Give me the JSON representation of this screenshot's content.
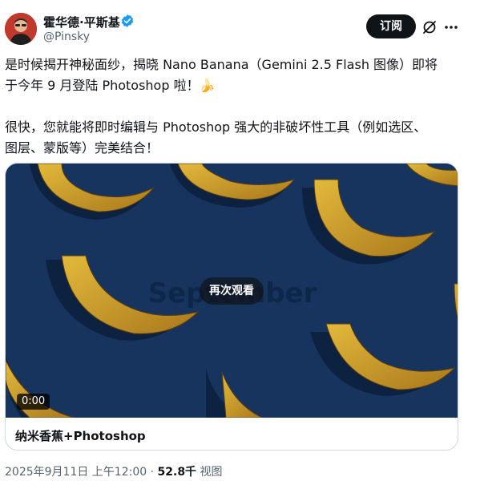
{
  "author": {
    "name": "霍华德·平斯基",
    "handle": "@Pinsky",
    "avatar_icon": "avatar-portrait"
  },
  "actions": {
    "subscribe_label": "订阅",
    "grok_icon": "grok-icon",
    "more_icon": "more-dots-icon"
  },
  "tweet": {
    "line1": "是时候揭开神秘面纱，揭晓 Nano Banana（Gemini 2.5 Flash 图像）即将",
    "line2": "于今年 9 月登陆 Photoshop 啦！🍌",
    "line3": "很快，您就能将即时编辑与 Photoshop 强大的非破坏性工具（例如选区、",
    "line4": "图层、蒙版等）完美结合！"
  },
  "media": {
    "overlay_text": "September",
    "replay_label": "再次观看",
    "duration": "0:00",
    "caption": "纳米香蕉+Photoshop",
    "background_color": "#17345e"
  },
  "meta": {
    "timestamp": "2025年9月11日 上午12:00",
    "separator": "·",
    "views_count": "52.8千",
    "views_label": "视图"
  },
  "colors": {
    "text": "#0f1419",
    "secondary": "#536471",
    "verified": "#1d9bf0",
    "button_bg": "#0f1419"
  }
}
